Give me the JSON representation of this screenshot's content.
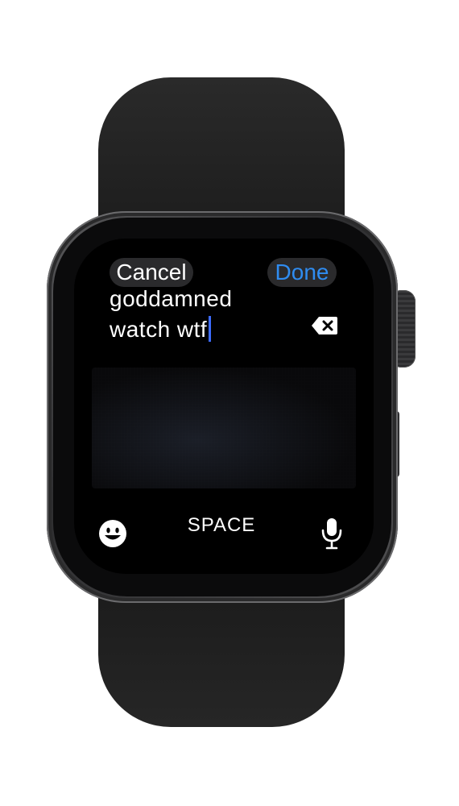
{
  "screen": {
    "cancel_label": "Cancel",
    "done_label": "Done",
    "text_lines": [
      "goddamned",
      "watch wtf"
    ],
    "space_label": "SPACE"
  },
  "icons": {
    "delete": "delete-backspace-icon",
    "emoji": "emoji-face-icon",
    "mic": "microphone-icon"
  },
  "colors": {
    "accent": "#2f8cf0",
    "cursor": "#3d6bff"
  }
}
